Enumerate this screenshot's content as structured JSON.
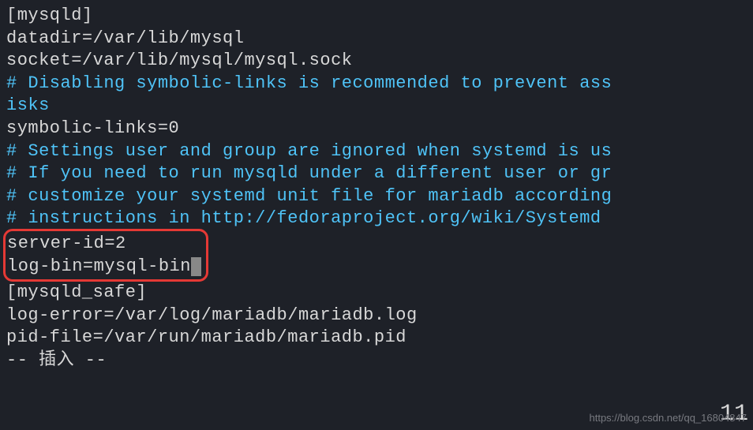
{
  "config": {
    "section1": "[mysqld]",
    "datadir": "datadir=/var/lib/mysql",
    "socket": "socket=/var/lib/mysql/mysql.sock",
    "comment1a": "# Disabling symbolic-links is recommended to prevent ass",
    "comment1b": "isks",
    "symlinks": "symbolic-links=0",
    "comment2": "# Settings user and group are ignored when systemd is us",
    "comment3": "# If you need to run mysqld under a different user or gr",
    "comment4": "# customize your systemd unit file for mariadb according",
    "comment5": "# instructions in http://fedoraproject.org/wiki/Systemd",
    "serverid": "server-id=2",
    "logbin": "log-bin=mysql-bin",
    "section2": "[mysqld_safe]",
    "logerror": "log-error=/var/log/mariadb/mariadb.log",
    "pidfile": "pid-file=/var/run/mariadb/mariadb.pid",
    "mode": "-- 插入 --"
  },
  "watermark": "https://blog.csdn.net/qq_16804847",
  "lineno": "11"
}
